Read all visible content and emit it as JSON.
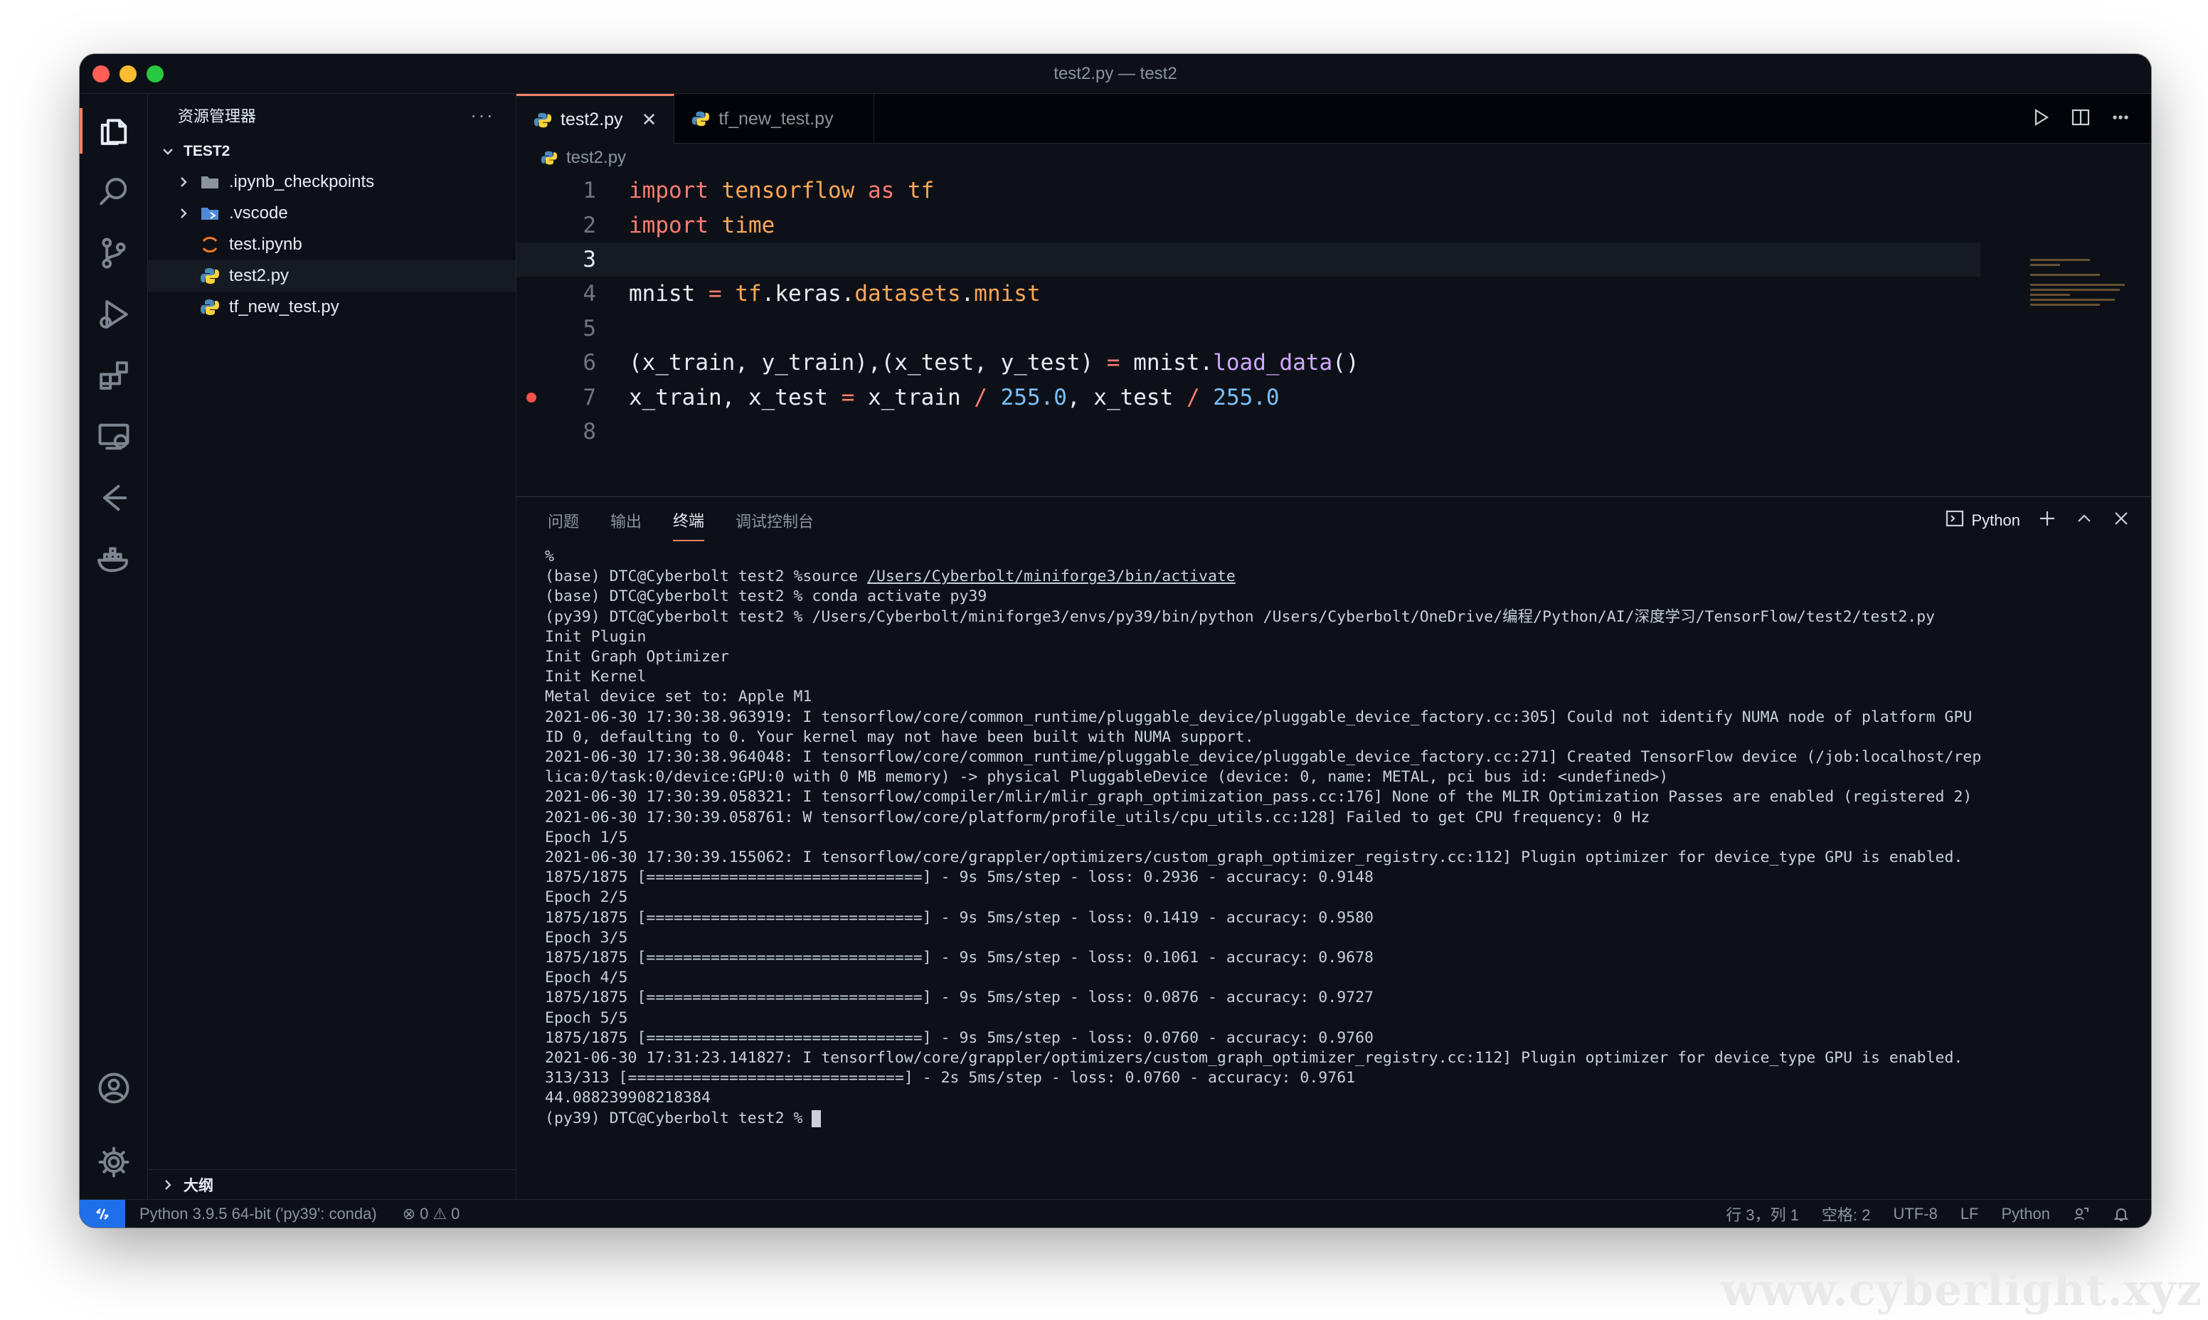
{
  "window": {
    "title": "test2.py — test2"
  },
  "sidebar": {
    "title": "资源管理器",
    "more": "···",
    "root": "TEST2",
    "items": [
      {
        "label": ".ipynb_checkpoints",
        "type": "folder"
      },
      {
        "label": ".vscode",
        "type": "folder-vscode"
      },
      {
        "label": "test.ipynb",
        "type": "notebook"
      },
      {
        "label": "test2.py",
        "type": "python",
        "selected": true
      },
      {
        "label": "tf_new_test.py",
        "type": "python"
      }
    ],
    "outline": "大纲"
  },
  "tabs": [
    {
      "label": "test2.py",
      "active": true,
      "close": "✕"
    },
    {
      "label": "tf_new_test.py",
      "active": false
    }
  ],
  "breadcrumb": "test2.py",
  "editor": {
    "line_numbers": [
      "1",
      "2",
      "3",
      "4",
      "5",
      "6",
      "7",
      "8"
    ],
    "current_line": 3,
    "breakpoint_line": 7
  },
  "panel": {
    "tabs": [
      "问题",
      "输出",
      "终端",
      "调试控制台"
    ],
    "active_tab": "终端",
    "terminal_name": "Python",
    "terminal_lines": [
      "%",
      "(base) DTC@Cyberbolt test2 %source /Users/Cyberbolt/miniforge3/bin/activate",
      "(base) DTC@Cyberbolt test2 % conda activate py39",
      "(py39) DTC@Cyberbolt test2 % /Users/Cyberbolt/miniforge3/envs/py39/bin/python /Users/Cyberbolt/OneDrive/编程/Python/AI/深度学习/TensorFlow/test2/test2.py",
      "Init Plugin",
      "Init Graph Optimizer",
      "Init Kernel",
      "Metal device set to: Apple M1",
      "2021-06-30 17:30:38.963919: I tensorflow/core/common_runtime/pluggable_device/pluggable_device_factory.cc:305] Could not identify NUMA node of platform GPU",
      "ID 0, defaulting to 0. Your kernel may not have been built with NUMA support.",
      "2021-06-30 17:30:38.964048: I tensorflow/core/common_runtime/pluggable_device/pluggable_device_factory.cc:271] Created TensorFlow device (/job:localhost/rep",
      "lica:0/task:0/device:GPU:0 with 0 MB memory) -> physical PluggableDevice (device: 0, name: METAL, pci bus id: <undefined>)",
      "2021-06-30 17:30:39.058321: I tensorflow/compiler/mlir/mlir_graph_optimization_pass.cc:176] None of the MLIR Optimization Passes are enabled (registered 2)",
      "2021-06-30 17:30:39.058761: W tensorflow/core/platform/profile_utils/cpu_utils.cc:128] Failed to get CPU frequency: 0 Hz",
      "Epoch 1/5",
      "2021-06-30 17:30:39.155062: I tensorflow/core/grappler/optimizers/custom_graph_optimizer_registry.cc:112] Plugin optimizer for device_type GPU is enabled.",
      "1875/1875 [==============================] - 9s 5ms/step - loss: 0.2936 - accuracy: 0.9148",
      "Epoch 2/5",
      "1875/1875 [==============================] - 9s 5ms/step - loss: 0.1419 - accuracy: 0.9580",
      "Epoch 3/5",
      "1875/1875 [==============================] - 9s 5ms/step - loss: 0.1061 - accuracy: 0.9678",
      "Epoch 4/5",
      "1875/1875 [==============================] - 9s 5ms/step - loss: 0.0876 - accuracy: 0.9727",
      "Epoch 5/5",
      "1875/1875 [==============================] - 9s 5ms/step - loss: 0.0760 - accuracy: 0.9760",
      "2021-06-30 17:31:23.141827: I tensorflow/core/grappler/optimizers/custom_graph_optimizer_registry.cc:112] Plugin optimizer for device_type GPU is enabled.",
      "313/313 [==============================] - 2s 5ms/step - loss: 0.0760 - accuracy: 0.9761",
      "44.088239908218384",
      "(py39) DTC@Cyberbolt test2 % "
    ]
  },
  "statusbar": {
    "interpreter": "Python 3.9.5 64-bit ('py39': conda)",
    "errors": "0",
    "warnings": "0",
    "position": "行 3，列 1",
    "spaces": "空格: 2",
    "encoding": "UTF-8",
    "eol": "LF",
    "language": "Python"
  },
  "watermark": "www.cyberlight.xyz",
  "colors": {
    "background": "#0d1117",
    "accent": "#f78166",
    "keyword": "#ff7b72",
    "module": "#ffa657",
    "number": "#79c0ff",
    "breakpoint": "#f85149"
  }
}
